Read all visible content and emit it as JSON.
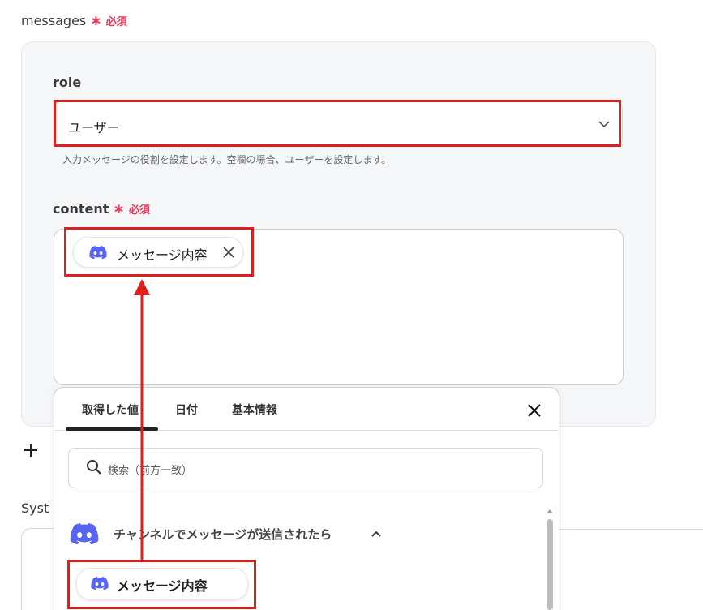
{
  "messages": {
    "label": "messages",
    "required_star": "∗",
    "required_text": "必須"
  },
  "role": {
    "label": "role",
    "selected": "ユーザー",
    "help": "入力メッセージの役割を設定します。空欄の場合、ユーザーを設定します。"
  },
  "content": {
    "label": "content",
    "required_star": "∗",
    "required_text": "必須",
    "chip_label": "メッセージ内容"
  },
  "system": {
    "label_partial": "Syst"
  },
  "popup": {
    "tabs": [
      {
        "label": "取得した値"
      },
      {
        "label": "日付"
      },
      {
        "label": "基本情報"
      }
    ],
    "search_placeholder": "検索（前方一致）",
    "section_title": "チャンネルでメッセージが送信されたら",
    "item_label": "メッセージ内容"
  },
  "colors": {
    "accent_red": "#e01e1e",
    "required_pink": "#e8385c",
    "discord_blurple": "#5865F2"
  },
  "icons": [
    "chevron-down-icon",
    "discord-icon",
    "close-icon",
    "plus-icon",
    "search-icon",
    "chevron-up-icon"
  ]
}
